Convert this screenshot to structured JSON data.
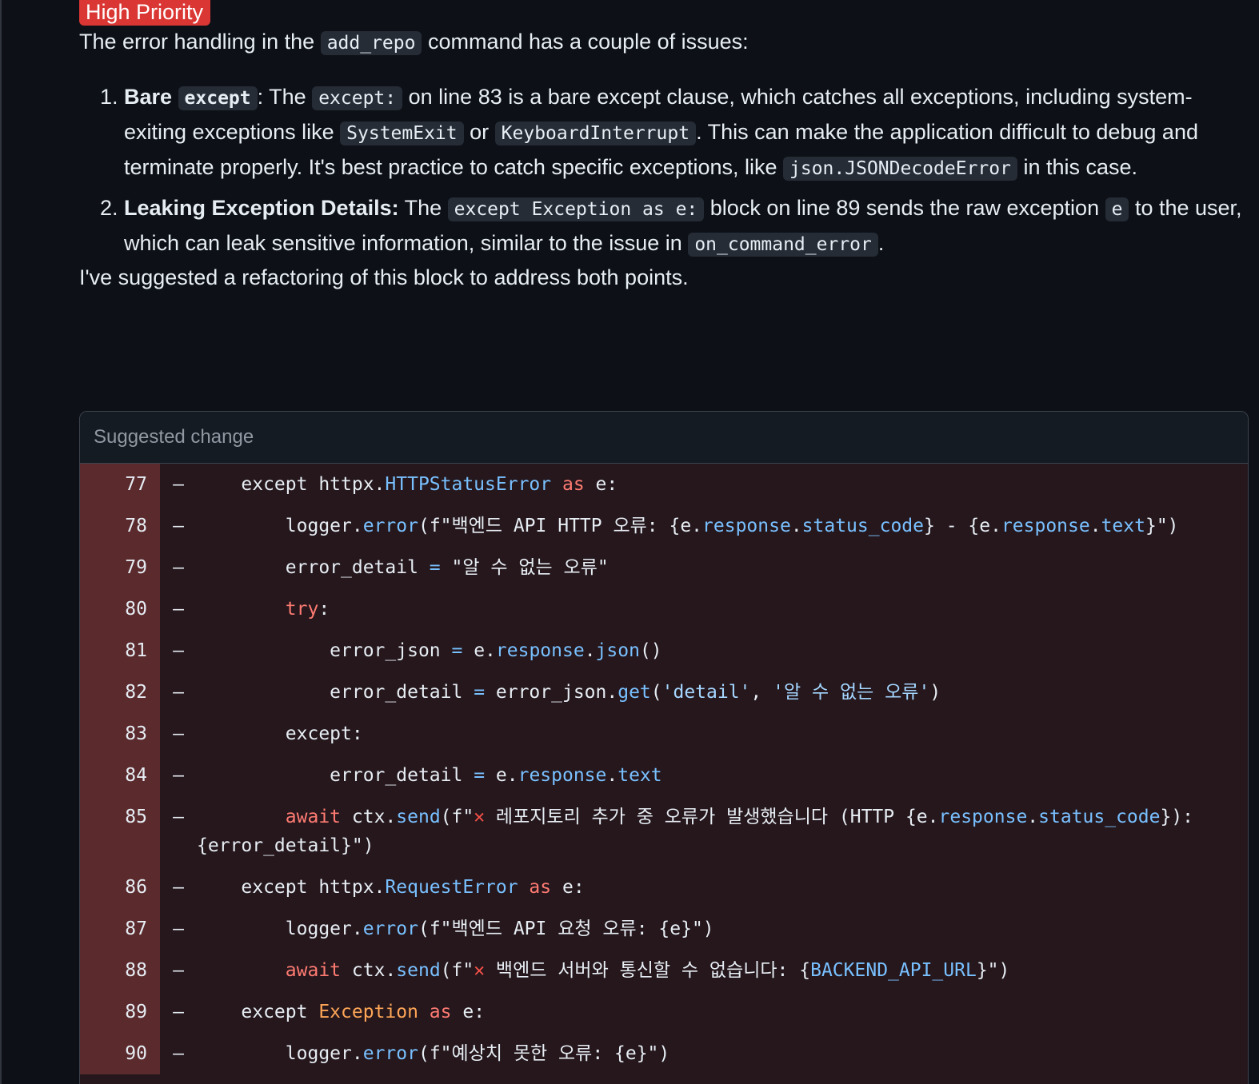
{
  "badge": "High Priority",
  "intro": {
    "before": "The error handling in the ",
    "code": "add_repo",
    "after": " command has a couple of issues:"
  },
  "issues": [
    {
      "title_before": "Bare ",
      "title_code": "except",
      "sep": ": The ",
      "code1": "except:",
      "text1": " on line 83 is a bare except clause, which catches all exceptions, including system-exiting exceptions like ",
      "code2": "SystemExit",
      "text2": " or ",
      "code3": "KeyboardInterrupt",
      "text3": ". This can make the application difficult to debug and terminate properly. It's best practice to catch specific exceptions, like ",
      "code4": "json.JSONDecodeError",
      "text4": " in this case."
    },
    {
      "title": "Leaking Exception Details:",
      "text0": " The ",
      "code1": "except Exception as e:",
      "text1": " block on line 89 sends the raw exception ",
      "code2": "e",
      "text2": " to the user, which can leak sensitive information, similar to the issue in ",
      "code3": "on_command_error",
      "text3": "."
    }
  ],
  "closing": "I've suggested a refactoring of this block to address both points.",
  "suggestion": {
    "header": "Suggested change",
    "marker": "–",
    "lines": [
      {
        "n": "77"
      },
      {
        "n": "78"
      },
      {
        "n": "79"
      },
      {
        "n": "80"
      },
      {
        "n": "81"
      },
      {
        "n": "82"
      },
      {
        "n": "83"
      },
      {
        "n": "84"
      },
      {
        "n": "85"
      },
      {
        "n": "86"
      },
      {
        "n": "87"
      },
      {
        "n": "88"
      },
      {
        "n": "89"
      },
      {
        "n": "90"
      }
    ],
    "code": {
      "l77": {
        "a": "    except httpx.",
        "b": "HTTPStatusError",
        "c": " as",
        "d": " e:"
      },
      "l78": {
        "a": "        logger.",
        "b": "error",
        "c": "(f\"백엔드 API HTTP 오류: {e.",
        "d": "response",
        "e": ".",
        "f": "status_code",
        "g": "} - {e.",
        "h": "response",
        "i": ".",
        "j": "text",
        "k": "}\")"
      },
      "l79": {
        "a": "        error_detail ",
        "b": "=",
        "c": " \"알 수 없는 오류\""
      },
      "l80": {
        "a": "        ",
        "b": "try",
        "c": ":"
      },
      "l81": {
        "a": "            error_json ",
        "b": "=",
        "c": " e.",
        "d": "response",
        "e": ".",
        "f": "json",
        "g": "()"
      },
      "l82": {
        "a": "            error_detail ",
        "b": "=",
        "c": " error_json.",
        "d": "get",
        "e": "(",
        "f": "'detail'",
        "g": ", ",
        "h": "'알 수 없는 오류'",
        "i": ")"
      },
      "l83": {
        "a": "        except:"
      },
      "l84": {
        "a": "            error_detail ",
        "b": "=",
        "c": " e.",
        "d": "response",
        "e": ".",
        "f": "text"
      },
      "l85": {
        "a": "        ",
        "b": "await",
        "c": " ctx.",
        "d": "send",
        "e": "(f\"",
        "x": "✕",
        "f": " 레포지토리 추가 중 오류가 발생했습니다 (HTTP {e.",
        "g": "response",
        "h": ".",
        "i": "status_code",
        "j": "}): {error_detail}\")"
      },
      "l86": {
        "a": "    except httpx.",
        "b": "RequestError",
        "c": " as",
        "d": " e:"
      },
      "l87": {
        "a": "        logger.",
        "b": "error",
        "c": "(f\"백엔드 API 요청 오류: {e}\")"
      },
      "l88": {
        "a": "        ",
        "b": "await",
        "c": " ctx.",
        "d": "send",
        "e": "(f\"",
        "x": "✕",
        "f": " 백엔드 서버와 통신할 수 없습니다: {",
        "g": "BACKEND_API_URL",
        "h": "}\")"
      },
      "l89": {
        "a": "    except ",
        "b": "Exception",
        "c": " as",
        "d": " e:"
      },
      "l90": {
        "a": "        logger.",
        "b": "error",
        "c": "(f\"예상치 못한 오류: {e}\")"
      }
    }
  },
  "colors": {
    "background": "#0d1117",
    "badge": "#da3633",
    "gutter_removed": "#5a2a2d",
    "line_removed": "#25171c",
    "keyword": "#ff7b72",
    "function": "#79c0ff",
    "class": "#ffa657"
  }
}
